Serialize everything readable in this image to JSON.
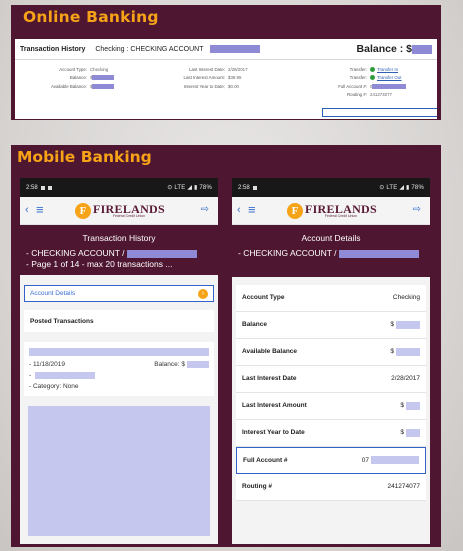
{
  "online": {
    "panel_title": "Online Banking",
    "header": {
      "title": "Transaction History",
      "account": "Checking : CHECKING ACCOUNT",
      "balance_label": "Balance : $"
    },
    "col1": [
      {
        "label": "Account Type:",
        "value": "Checking"
      },
      {
        "label": "Balance:",
        "value": "$"
      },
      {
        "label": "Available Balance:",
        "value": "$"
      }
    ],
    "col2": [
      {
        "label": "Last Interest Date:",
        "value": "2/28/2017"
      },
      {
        "label": "Last Interest Amount:",
        "value": "$39.95"
      },
      {
        "label": "Interest Year to Date:",
        "value": "$0.00"
      }
    ],
    "col3": [
      {
        "label": "Transfer:",
        "link": "Transfer In"
      },
      {
        "label": "Transfer:",
        "link": "Transfer Out"
      },
      {
        "label": "Full Account #:",
        "value": "0"
      },
      {
        "label": "Routing #:",
        "value": "241274077"
      }
    ]
  },
  "mobile": {
    "panel_title": "Mobile Banking",
    "status": {
      "time": "2:58",
      "indicators": "⊙ LTE ◢ ▮ 78%"
    },
    "logo": {
      "name": "FIRELANDS",
      "tagline": "Federal Credit Union"
    },
    "phone1": {
      "title": "Transaction History",
      "line1": "- CHECKING ACCOUNT /",
      "line2": "- Page 1 of 14  - max 20 transactions ...",
      "account_details": "Account Details",
      "posted": "Posted Transactions",
      "txn_date": "- 11/18/2019",
      "txn_balance": "Balance: $",
      "txn_category": "- Category: None"
    },
    "phone2": {
      "title": "Account Details",
      "line1": "- CHECKING ACCOUNT /",
      "rows": [
        {
          "label": "Account Type",
          "value": "Checking"
        },
        {
          "label": "Balance",
          "value": "$"
        },
        {
          "label": "Available Balance",
          "value": "$"
        },
        {
          "label": "Last Interest Date",
          "value": "2/28/2017"
        },
        {
          "label": "Last Interest Amount",
          "value": "$"
        },
        {
          "label": "Interest Year to Date",
          "value": "$"
        },
        {
          "label": "Full Account #",
          "value": "07"
        },
        {
          "label": "Routing #",
          "value": "241274077"
        }
      ]
    }
  },
  "colors": {
    "panel": "#4e1631",
    "accent": "#f6a317",
    "highlight": "#3362c9",
    "redaction": "#8f8ad6"
  }
}
